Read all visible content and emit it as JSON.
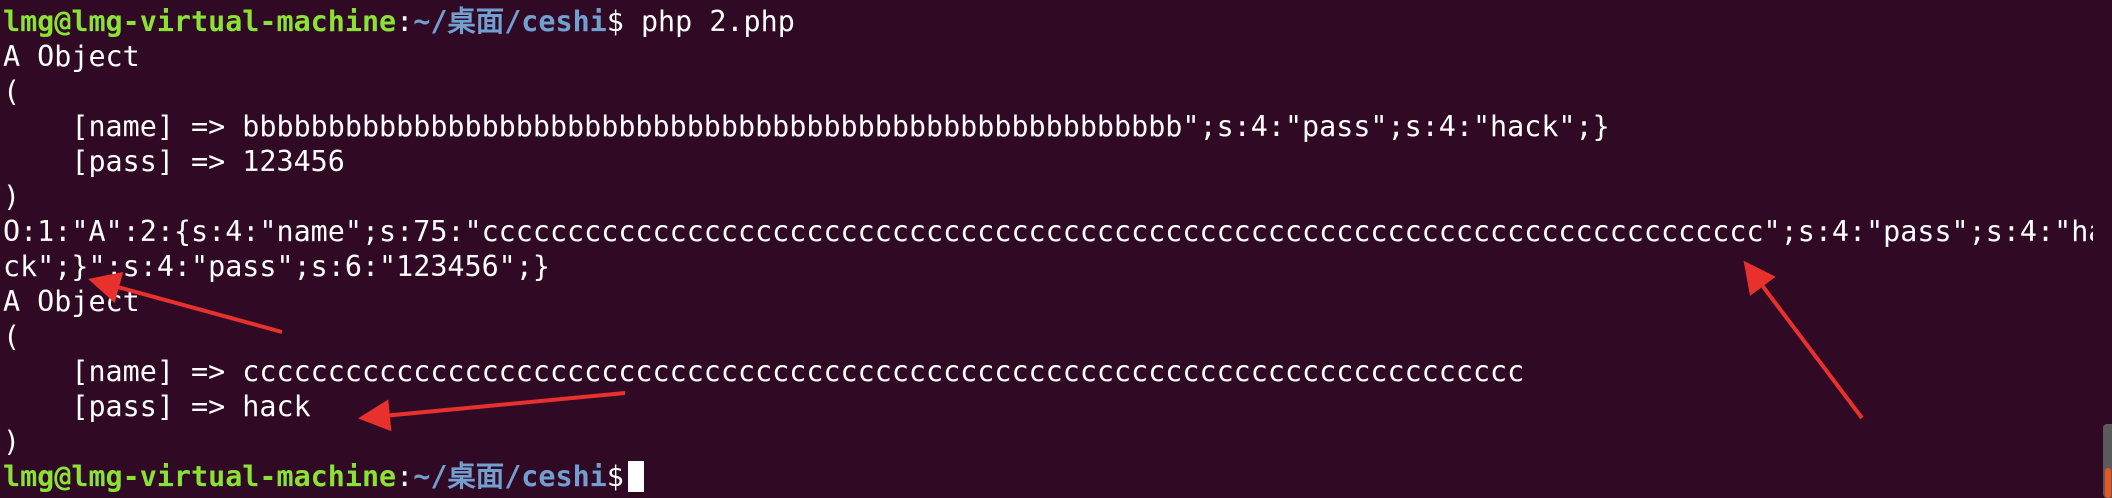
{
  "prompt": {
    "user_host": "lmg@lmg-virtual-machine",
    "separator": ":",
    "path": "~/桌面/ceshi",
    "sign": "$"
  },
  "command": " php 2.php",
  "output_lines": [
    "A Object",
    "(",
    "    [name] => bbbbbbbbbbbbbbbbbbbbbbbbbbbbbbbbbbbbbbbbbbbbbbbbbbbbbbb\";s:4:\"pass\";s:4:\"hack\";}",
    "    [pass] => 123456",
    ")",
    "O:1:\"A\":2:{s:4:\"name\";s:75:\"ccccccccccccccccccccccccccccccccccccccccccccccccccccccccccccccccccccccccccc\";s:4:\"pass\";s:4:\"ha",
    "ck\";}\";s:4:\"pass\";s:6:\"123456\";}",
    "A Object",
    "(",
    "    [name] => ccccccccccccccccccccccccccccccccccccccccccccccccccccccccccccccccccccccccccc",
    "    [pass] => hack",
    ")"
  ],
  "annotation_color": "#e8302c",
  "scrollbar_accent": "#e95420"
}
